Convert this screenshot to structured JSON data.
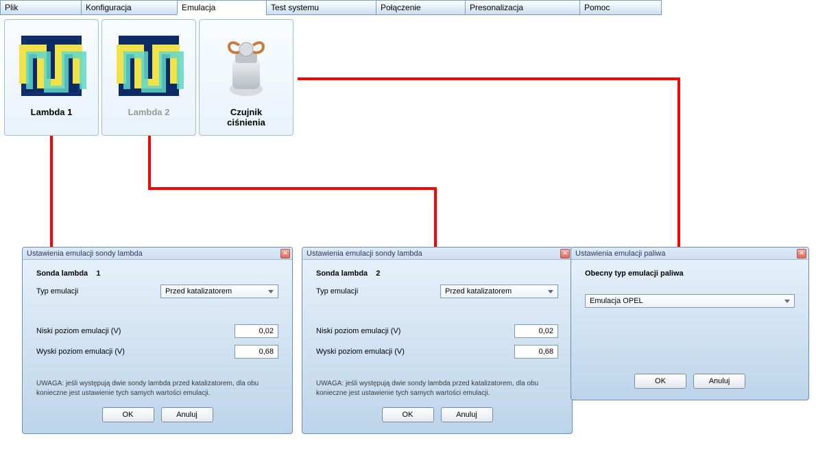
{
  "tabs": {
    "plik": "Plik",
    "konfiguracja": "Konfiguracja",
    "emulacja": "Emulacja",
    "test": "Test systemu",
    "polaczenie": "Połączenie",
    "presonalizacja": "Presonalizacja",
    "pomoc": "Pomoc"
  },
  "tab_widths": {
    "plik": 118,
    "konfiguracja": 140,
    "emulacja": 130,
    "test": 160,
    "polaczenie": 130,
    "presonalizacja": 167,
    "pomoc": 120
  },
  "modules": {
    "lambda1": "Lambda 1",
    "lambda2": "Lambda 2",
    "czujnik_line1": "Czujnik",
    "czujnik_line2": "ciśnienia"
  },
  "dlg1": {
    "title": "Ustawienia emulacji sondy lambda",
    "heading_label": "Sonda lambda",
    "heading_num": "1",
    "typ_label": "Typ emulacji",
    "typ_value": "Przed katalizatorem",
    "low_label": "Niski poziom emulacji (V)",
    "low_value": "0,02",
    "high_label": "Wyski poziom emulacji (V)",
    "high_value": "0,68",
    "warning": "UWAGA: jeśli występują dwie sondy lambda przed katalizatorem, dla obu konieczne jest ustawienie tych samych wartości emulacji.",
    "ok": "OK",
    "cancel": "Anuluj"
  },
  "dlg2": {
    "title": "Ustawienia emulacji sondy lambda",
    "heading_label": "Sonda lambda",
    "heading_num": "2",
    "typ_label": "Typ emulacji",
    "typ_value": "Przed katalizatorem",
    "low_label": "Niski poziom emulacji (V)",
    "low_value": "0,02",
    "high_label": "Wyski poziom emulacji (V)",
    "high_value": "0,68",
    "warning": "UWAGA: jeśli występują dwie sondy lambda przed katalizatorem, dla obu konieczne jest ustawienie tych samych wartości emulacji.",
    "ok": "OK",
    "cancel": "Anuluj"
  },
  "dlg3": {
    "title": "Ustawienia emulacji paliwa",
    "heading": "Obecny typ emulacji paliwa",
    "sel_value": "Emulacja OPEL",
    "ok": "OK",
    "cancel": "Anuluj"
  }
}
